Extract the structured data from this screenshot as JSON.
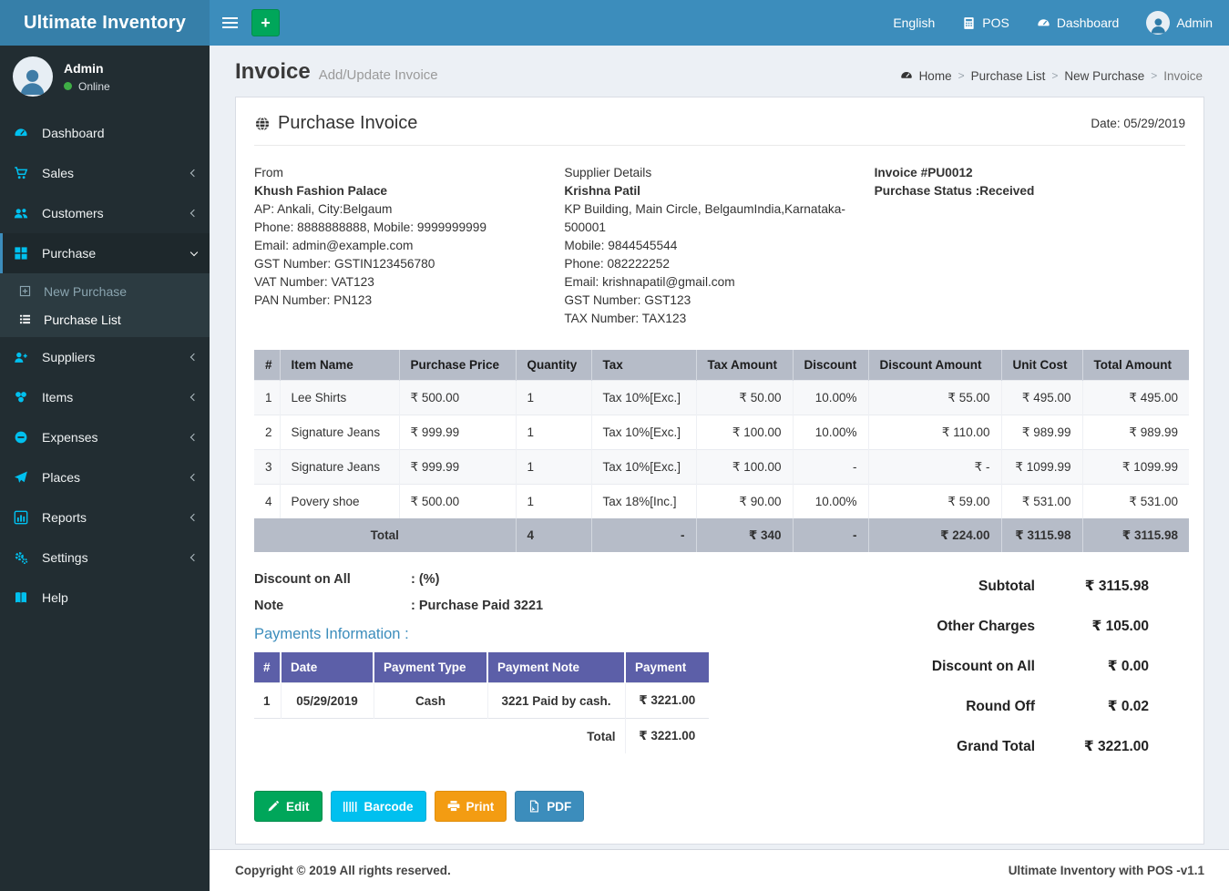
{
  "brand": "Ultimate Inventory",
  "navbar": {
    "add_glyph": "+",
    "language": "English",
    "pos": "POS",
    "dashboard": "Dashboard",
    "user": "Admin"
  },
  "sidebar": {
    "user": {
      "name": "Admin",
      "status": "Online"
    },
    "items": [
      {
        "label": "Dashboard"
      },
      {
        "label": "Sales"
      },
      {
        "label": "Customers"
      },
      {
        "label": "Purchase",
        "children": [
          {
            "label": "New Purchase"
          },
          {
            "label": "Purchase List"
          }
        ]
      },
      {
        "label": "Suppliers"
      },
      {
        "label": "Items"
      },
      {
        "label": "Expenses"
      },
      {
        "label": "Places"
      },
      {
        "label": "Reports"
      },
      {
        "label": "Settings"
      },
      {
        "label": "Help"
      }
    ]
  },
  "page_header": {
    "title": "Invoice",
    "subtitle": "Add/Update Invoice",
    "breadcrumb": [
      "Home",
      "Purchase List",
      "New Purchase",
      "Invoice"
    ]
  },
  "invoice": {
    "title": "Purchase Invoice",
    "date": "Date: 05/29/2019",
    "from": {
      "heading": "From",
      "name": "Khush Fashion Palace",
      "lines": [
        "AP: Ankali, City:Belgaum",
        "Phone: 8888888888, Mobile: 9999999999",
        "Email: admin@example.com",
        "GST Number: GSTIN123456780",
        "VAT Number: VAT123",
        "PAN Number: PN123"
      ]
    },
    "supplier": {
      "heading": "Supplier Details",
      "name": "Krishna Patil",
      "lines": [
        "KP Building, Main Circle, BelgaumIndia,Karnataka-500001",
        "Mobile: 9844545544",
        "Phone: 082222252",
        "Email: krishnapatil@gmail.com",
        "GST Number: GST123",
        "TAX Number: TAX123"
      ]
    },
    "meta": {
      "invoice_no": "Invoice #PU0012",
      "status": "Purchase Status :Received"
    },
    "items_table": {
      "headers": [
        "#",
        "Item Name",
        "Purchase Price",
        "Quantity",
        "Tax",
        "Tax Amount",
        "Discount",
        "Discount Amount",
        "Unit Cost",
        "Total Amount"
      ],
      "rows": [
        [
          "1",
          "Lee Shirts",
          "₹ 500.00",
          "1",
          "Tax 10%[Exc.]",
          "₹ 50.00",
          "10.00%",
          "₹ 55.00",
          "₹ 495.00",
          "₹ 495.00"
        ],
        [
          "2",
          "Signature Jeans",
          "₹ 999.99",
          "1",
          "Tax 10%[Exc.]",
          "₹ 100.00",
          "10.00%",
          "₹ 110.00",
          "₹ 989.99",
          "₹ 989.99"
        ],
        [
          "3",
          "Signature Jeans",
          "₹ 999.99",
          "1",
          "Tax 10%[Exc.]",
          "₹ 100.00",
          "-",
          "₹ -",
          "₹ 1099.99",
          "₹ 1099.99"
        ],
        [
          "4",
          "Povery shoe",
          "₹ 500.00",
          "1",
          "Tax 18%[Inc.]",
          "₹ 90.00",
          "10.00%",
          "₹ 59.00",
          "₹ 531.00",
          "₹ 531.00"
        ]
      ],
      "total_row": {
        "label": "Total",
        "quantity": "4",
        "tax": "-",
        "tax_amount": "₹ 340",
        "discount": "-",
        "discount_amount": "₹ 224.00",
        "unit_cost": "₹ 3115.98",
        "total_amount": "₹ 3115.98"
      }
    },
    "discount_on_all": {
      "label": "Discount on All",
      "value": ": (%)"
    },
    "note": {
      "label": "Note",
      "value": ": Purchase Paid 3221"
    },
    "payments": {
      "heading": "Payments Information :",
      "headers": [
        "#",
        "Date",
        "Payment Type",
        "Payment Note",
        "Payment"
      ],
      "rows": [
        [
          "1",
          "05/29/2019",
          "Cash",
          "3221 Paid by cash.",
          "₹ 3221.00"
        ]
      ],
      "total_label": "Total",
      "total_value": "₹ 3221.00"
    },
    "summary": {
      "rows": [
        {
          "label": "Subtotal",
          "value": "₹ 3115.98"
        },
        {
          "label": "Other Charges",
          "value": "₹ 105.00"
        },
        {
          "label": "Discount on All",
          "value": "₹ 0.00"
        },
        {
          "label": "Round Off",
          "value": "₹ 0.02"
        },
        {
          "label": "Grand Total",
          "value": "₹ 3221.00"
        }
      ]
    },
    "buttons": {
      "edit": "Edit",
      "barcode": "Barcode",
      "print": "Print",
      "pdf": "PDF"
    }
  },
  "footer": {
    "left": "Copyright © 2019 All rights reserved.",
    "right": "Ultimate Inventory with POS -v1.1"
  },
  "colors": {
    "navbar": "#3c8dbc",
    "logo_bg": "#367fa9",
    "sidebar_bg": "#222d32",
    "sidebar_icon": "#00c0ef",
    "items_header": "#b6bcc8",
    "payments_header": "#5c5fa8",
    "btn_edit": "#00a65a",
    "btn_barcode": "#00c0ef",
    "btn_print": "#f39c12",
    "btn_pdf": "#3c8dbc",
    "online_dot": "#3fae46"
  }
}
